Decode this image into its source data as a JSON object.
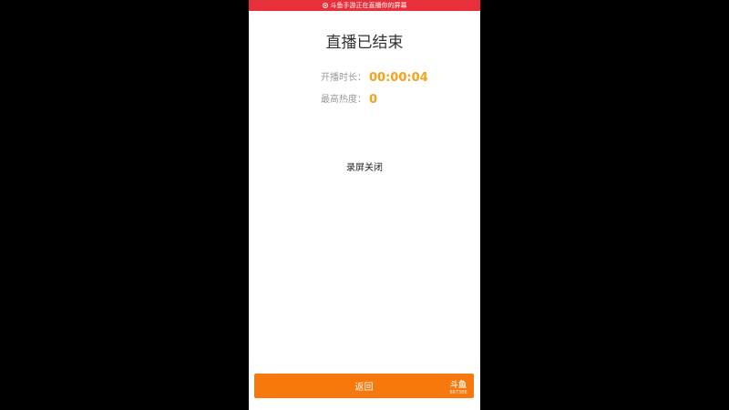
{
  "status_bar": {
    "recording_text": "斗鱼手游正在直播你的屏幕",
    "color": "#e8303a"
  },
  "main": {
    "title": "直播已结束",
    "stats": [
      {
        "label": "开播时长：",
        "value": "00:00:04"
      },
      {
        "label": "最高热度：",
        "value": "0"
      }
    ],
    "record_status": "录屏关闭"
  },
  "footer": {
    "back_label": "返回",
    "button_color": "#f7780c",
    "watermark_mark": "斗鱼",
    "watermark_id": "667386"
  },
  "colors": {
    "accent": "#f7a21b",
    "background": "#000000"
  }
}
